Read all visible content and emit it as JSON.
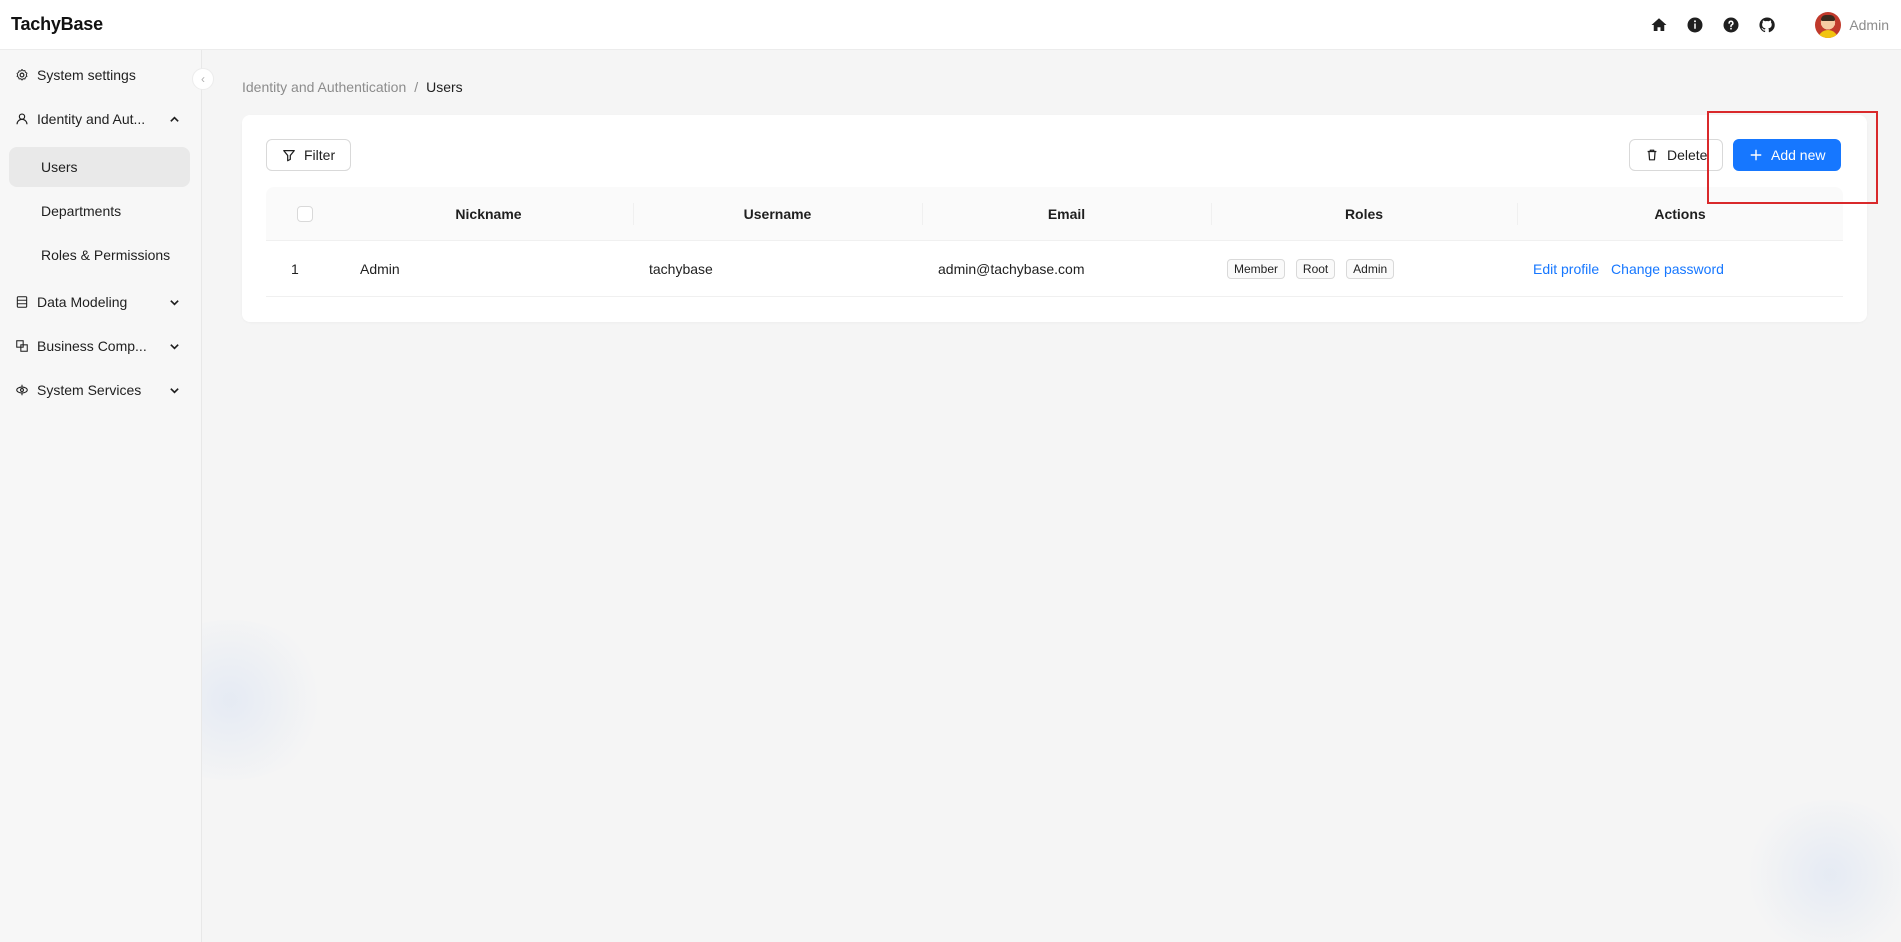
{
  "app": {
    "brand": "TachyBase"
  },
  "header": {
    "icons": [
      "home-icon",
      "info-icon",
      "help-icon",
      "github-icon"
    ],
    "user_name": "Admin"
  },
  "sidebar": {
    "items": [
      {
        "label": "System settings",
        "icon": "gear-icon"
      },
      {
        "label": "Identity and Aut...",
        "icon": "user-icon",
        "expanded": true
      },
      {
        "label": "Data Modeling",
        "icon": "database-icon"
      },
      {
        "label": "Business Comp...",
        "icon": "components-icon"
      },
      {
        "label": "System Services",
        "icon": "services-icon"
      }
    ],
    "subitems": [
      {
        "label": "Users",
        "active": true
      },
      {
        "label": "Departments"
      },
      {
        "label": "Roles & Permissions"
      }
    ]
  },
  "breadcrumb": {
    "parent": "Identity and Authentication",
    "separator": "/",
    "current": "Users"
  },
  "toolbar": {
    "filter_label": "Filter",
    "delete_label": "Delete",
    "add_label": "Add new"
  },
  "table": {
    "columns": [
      "Nickname",
      "Username",
      "Email",
      "Roles",
      "Actions"
    ],
    "rows": [
      {
        "index": "1",
        "nickname": "Admin",
        "username": "tachybase",
        "email": "admin@tachybase.com",
        "roles": [
          "Member",
          "Root",
          "Admin"
        ],
        "actions": [
          "Edit profile",
          "Change password"
        ]
      }
    ]
  },
  "colors": {
    "primary": "#1677ff",
    "highlight": "#d9292b"
  }
}
